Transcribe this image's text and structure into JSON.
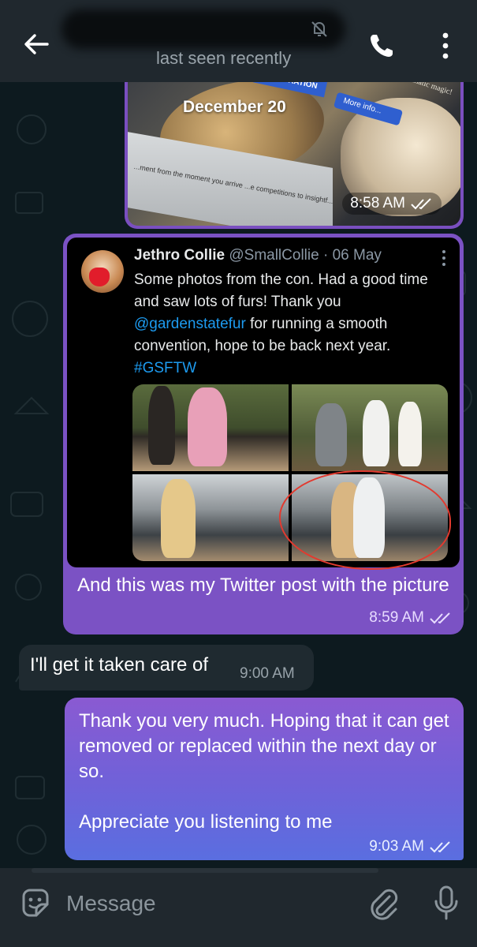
{
  "header": {
    "status": "last seen recently"
  },
  "chat": {
    "date_label": "December 20",
    "photo_message": {
      "time": "8:58 AM",
      "overlay_texts": [
        "REGISTRATION",
        "More info...",
        "...ow and join ...matic magic!",
        "...ment from the moment you arrive ...e competitions to insightf..."
      ]
    },
    "tweet": {
      "author_name": "Jethro Collie",
      "author_handle": "@SmallCollie",
      "date": "· 06 May",
      "text_before_link": "Some photos from the con. Had a good time and saw lots of furs! Thank you ",
      "mention": "@gardenstatefur",
      "text_after_link": " for running a smooth convention, hope to be back next year.",
      "hashtag": "#GSFTW",
      "caption": "And this was my Twitter post with the picture",
      "time": "8:59 AM"
    },
    "incoming": {
      "text": "I'll get it taken care of",
      "time": "9:00 AM"
    },
    "outgoing": {
      "paragraph1": "Thank you very much.  Hoping that it can get removed or replaced within the next day or so.",
      "paragraph2": "Appreciate you listening to me",
      "time": "9:03 AM"
    }
  },
  "composer": {
    "placeholder": "Message"
  },
  "colors": {
    "header_bg": "#20282e",
    "outgoing_bubble": "#7b52c4",
    "incoming_bubble": "#1f2a30",
    "link": "#1d9bf0"
  },
  "icons": {
    "back": "arrow-left-icon",
    "call": "phone-icon",
    "menu": "vertical-dots-icon",
    "mute": "muted-bell-icon",
    "read": "double-check-icon",
    "sticker": "sticker-icon",
    "attach": "paperclip-icon",
    "mic": "microphone-icon"
  }
}
